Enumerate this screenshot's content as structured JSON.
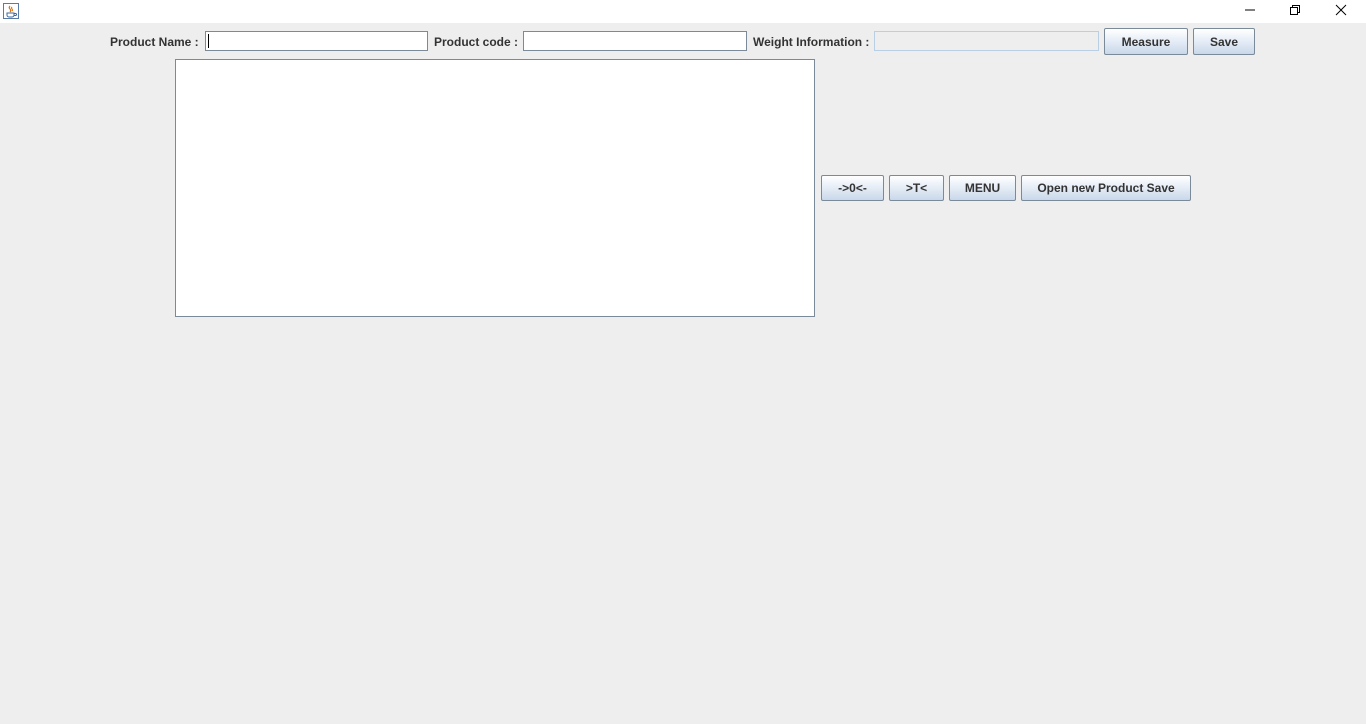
{
  "window": {
    "controls": {
      "minimize_icon": "minimize-icon",
      "maximize_icon": "restore-icon",
      "close_icon": "close-icon"
    },
    "app_icon": "java-coffee-cup-icon"
  },
  "form": {
    "product_name_label": "Product Name :",
    "product_name_value": "",
    "product_code_label": "Product code :",
    "product_code_value": "",
    "weight_info_label": "Weight Information :",
    "weight_info_value": "",
    "measure_button": "Measure",
    "save_button": "Save"
  },
  "output_area": {
    "text": ""
  },
  "actions": {
    "zero_button": "->0<-",
    "tare_button": ">T<",
    "menu_button": "MENU",
    "open_new_product_save_button": "Open new Product Save"
  },
  "colors": {
    "background": "#eeeeee",
    "button_border": "#7a8a99",
    "button_gradient_bottom": "#c9d8ea"
  }
}
